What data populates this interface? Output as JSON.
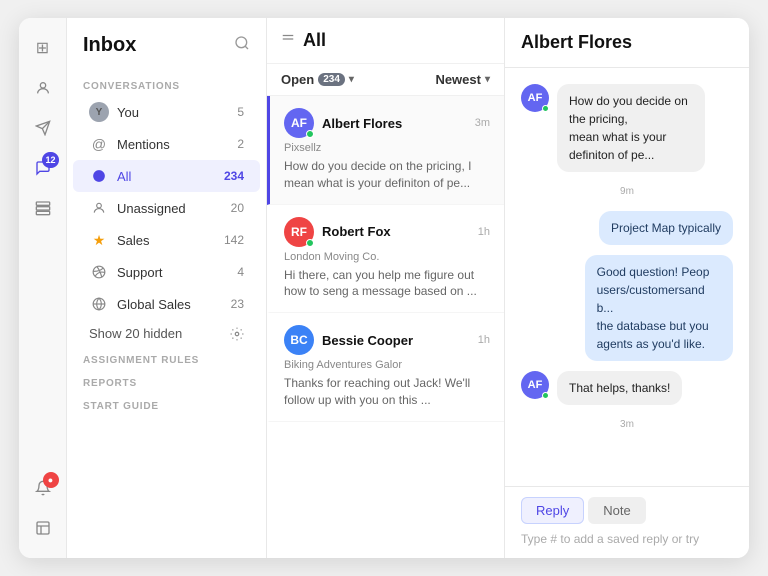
{
  "iconBar": {
    "icons": [
      {
        "name": "grid-icon",
        "symbol": "⊞",
        "active": false,
        "badge": null
      },
      {
        "name": "contact-icon",
        "symbol": "👤",
        "active": false,
        "badge": null
      },
      {
        "name": "send-icon",
        "symbol": "➤",
        "active": false,
        "badge": null
      },
      {
        "name": "chat-icon",
        "symbol": "💬",
        "active": true,
        "badge": "12",
        "badgeColor": "blue"
      },
      {
        "name": "layers-icon",
        "symbol": "⧉",
        "active": false,
        "badge": null
      },
      {
        "name": "bell-icon",
        "symbol": "🔔",
        "active": false,
        "badge": "●",
        "badgeColor": "red"
      },
      {
        "name": "book-icon",
        "symbol": "📄",
        "active": false,
        "badge": null
      }
    ]
  },
  "sidebar": {
    "title": "Inbox",
    "sections": {
      "conversations": "CONVERSATIONS",
      "assignmentRules": "ASSIGNMENT RULES",
      "reports": "REPORTS",
      "startGuide": "START GUIDE"
    },
    "navItems": [
      {
        "id": "you",
        "label": "You",
        "count": "5",
        "type": "avatar",
        "avatarBg": "#9ca3af",
        "avatarText": "Y"
      },
      {
        "id": "mentions",
        "label": "Mentions",
        "count": "2",
        "type": "icon",
        "symbol": "@"
      },
      {
        "id": "all",
        "label": "All",
        "count": "234",
        "type": "icon",
        "symbol": "✦",
        "active": true
      },
      {
        "id": "unassigned",
        "label": "Unassigned",
        "count": "20",
        "type": "icon",
        "symbol": "👤"
      },
      {
        "id": "sales",
        "label": "Sales",
        "count": "142",
        "type": "icon",
        "symbol": "★"
      },
      {
        "id": "support",
        "label": "Support",
        "count": "4",
        "type": "icon",
        "symbol": "🎧"
      },
      {
        "id": "globalSales",
        "label": "Global Sales",
        "count": "23",
        "type": "icon",
        "symbol": "🌐"
      }
    ],
    "showHidden": "Show 20 hidden"
  },
  "convList": {
    "title": "All",
    "filter": {
      "status": "Open",
      "count": "234",
      "sort": "Newest"
    },
    "conversations": [
      {
        "id": "albert",
        "name": "Albert Flores",
        "company": "Pixsellz",
        "time": "3m",
        "preview": "How do you decide on the pricing, I mean what is your definiton of pe...",
        "avatarBg": "#6366f1",
        "avatarText": "AF",
        "online": true,
        "active": true
      },
      {
        "id": "robert",
        "name": "Robert Fox",
        "company": "London Moving Co.",
        "time": "1h",
        "preview": "Hi there, can you help me figure out how to seng a message based on ...",
        "avatarBg": "#ef4444",
        "avatarText": "RF",
        "online": true,
        "active": false
      },
      {
        "id": "bessie",
        "name": "Bessie Cooper",
        "company": "Biking Adventures Galor",
        "time": "1h",
        "preview": "Thanks for reaching out Jack! We'll follow up with you on this ...",
        "avatarBg": "#3b82f6",
        "avatarText": "BC",
        "online": false,
        "active": false
      }
    ]
  },
  "chatPanel": {
    "title": "Albert Flores",
    "messages": [
      {
        "id": "m1",
        "type": "incoming",
        "text": "How do you decide on the pricing, mean what is your definiton of pe...",
        "avatarBg": "#6366f1",
        "avatarText": "AF",
        "online": true,
        "timeAfter": "9m"
      },
      {
        "id": "m2",
        "type": "outgoing",
        "text": "Project Map typically",
        "timeAfter": null
      },
      {
        "id": "m3",
        "type": "outgoing",
        "text": "Good question! People users/customersand b... the database but you agents as you'd like.",
        "timeAfter": null
      },
      {
        "id": "m4",
        "type": "incoming",
        "text": "That helps, thanks!",
        "avatarBg": "#6366f1",
        "avatarText": "AF",
        "online": true,
        "timeAfter": "3m"
      }
    ],
    "replyBar": {
      "tabs": [
        {
          "label": "Reply",
          "active": true
        },
        {
          "label": "Note",
          "active": false
        }
      ],
      "placeholder": "Type # to add a saved reply or try"
    }
  }
}
